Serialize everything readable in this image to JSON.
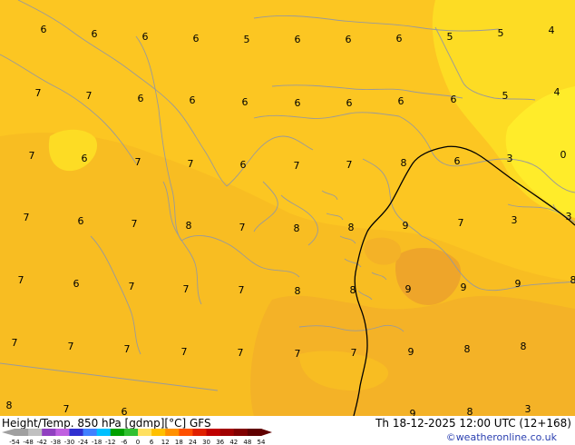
{
  "title": "Height/Temp. 850 hPa [gdmp][°C] GFS",
  "valid_time": "Th 18-12-2025 12:00 UTC (12+168)",
  "credit": "©weatheronline.co.uk",
  "colorbar": {
    "ticks": [
      "-54",
      "-48",
      "-42",
      "-38",
      "-30",
      "-24",
      "-18",
      "-12",
      "-6",
      "0",
      "6",
      "12",
      "18",
      "24",
      "30",
      "36",
      "42",
      "48",
      "54"
    ],
    "colors": [
      "#a0a0a0",
      "#c0c0c0",
      "#9040c0",
      "#c060e0",
      "#3030d0",
      "#4080ff",
      "#00c0ff",
      "#00a000",
      "#30c030",
      "#ffe060",
      "#ffc000",
      "#ff9000",
      "#ff5000",
      "#e02000",
      "#c00000",
      "#a00000",
      "#800000",
      "#600000"
    ]
  },
  "colors": {
    "base": "#fcc622",
    "warm": "#f8bd22",
    "warmer": "#f4b227",
    "warmest": "#eea52a",
    "cool": "#fddc24",
    "cooler": "#ffec2a",
    "coast": "#9a9a9a",
    "contour": "#000000"
  },
  "contour_labels": [
    {
      "v": "6"
    },
    {
      "v": "6"
    },
    {
      "v": "6"
    },
    {
      "v": "6"
    },
    {
      "v": "5"
    },
    {
      "v": "6"
    },
    {
      "v": "6"
    },
    {
      "v": "6"
    },
    {
      "v": "5"
    },
    {
      "v": "5"
    },
    {
      "v": "4"
    },
    {
      "v": "7"
    },
    {
      "v": "7"
    },
    {
      "v": "6"
    },
    {
      "v": "6"
    },
    {
      "v": "6"
    },
    {
      "v": "6"
    },
    {
      "v": "6"
    },
    {
      "v": "6"
    },
    {
      "v": "6"
    },
    {
      "v": "5"
    },
    {
      "v": "4"
    },
    {
      "v": "7"
    },
    {
      "v": "6"
    },
    {
      "v": "7"
    },
    {
      "v": "7"
    },
    {
      "v": "6"
    },
    {
      "v": "7"
    },
    {
      "v": "7"
    },
    {
      "v": "8"
    },
    {
      "v": "6"
    },
    {
      "v": "3"
    },
    {
      "v": "0"
    },
    {
      "v": "7"
    },
    {
      "v": "6"
    },
    {
      "v": "7"
    },
    {
      "v": "8"
    },
    {
      "v": "7"
    },
    {
      "v": "8"
    },
    {
      "v": "8"
    },
    {
      "v": "9"
    },
    {
      "v": "7"
    },
    {
      "v": "3"
    },
    {
      "v": "3"
    },
    {
      "v": "7"
    },
    {
      "v": "6"
    },
    {
      "v": "7"
    },
    {
      "v": "7"
    },
    {
      "v": "7"
    },
    {
      "v": "8"
    },
    {
      "v": "8"
    },
    {
      "v": "9"
    },
    {
      "v": "9"
    },
    {
      "v": "9"
    },
    {
      "v": "8"
    },
    {
      "v": "7"
    },
    {
      "v": "7"
    },
    {
      "v": "7"
    },
    {
      "v": "7"
    },
    {
      "v": "7"
    },
    {
      "v": "7"
    },
    {
      "v": "7"
    },
    {
      "v": "9"
    },
    {
      "v": "8"
    },
    {
      "v": "8"
    },
    {
      "v": "8"
    },
    {
      "v": "7"
    },
    {
      "v": "6"
    },
    {
      "v": "9"
    },
    {
      "v": "8"
    },
    {
      "v": "3"
    }
  ]
}
